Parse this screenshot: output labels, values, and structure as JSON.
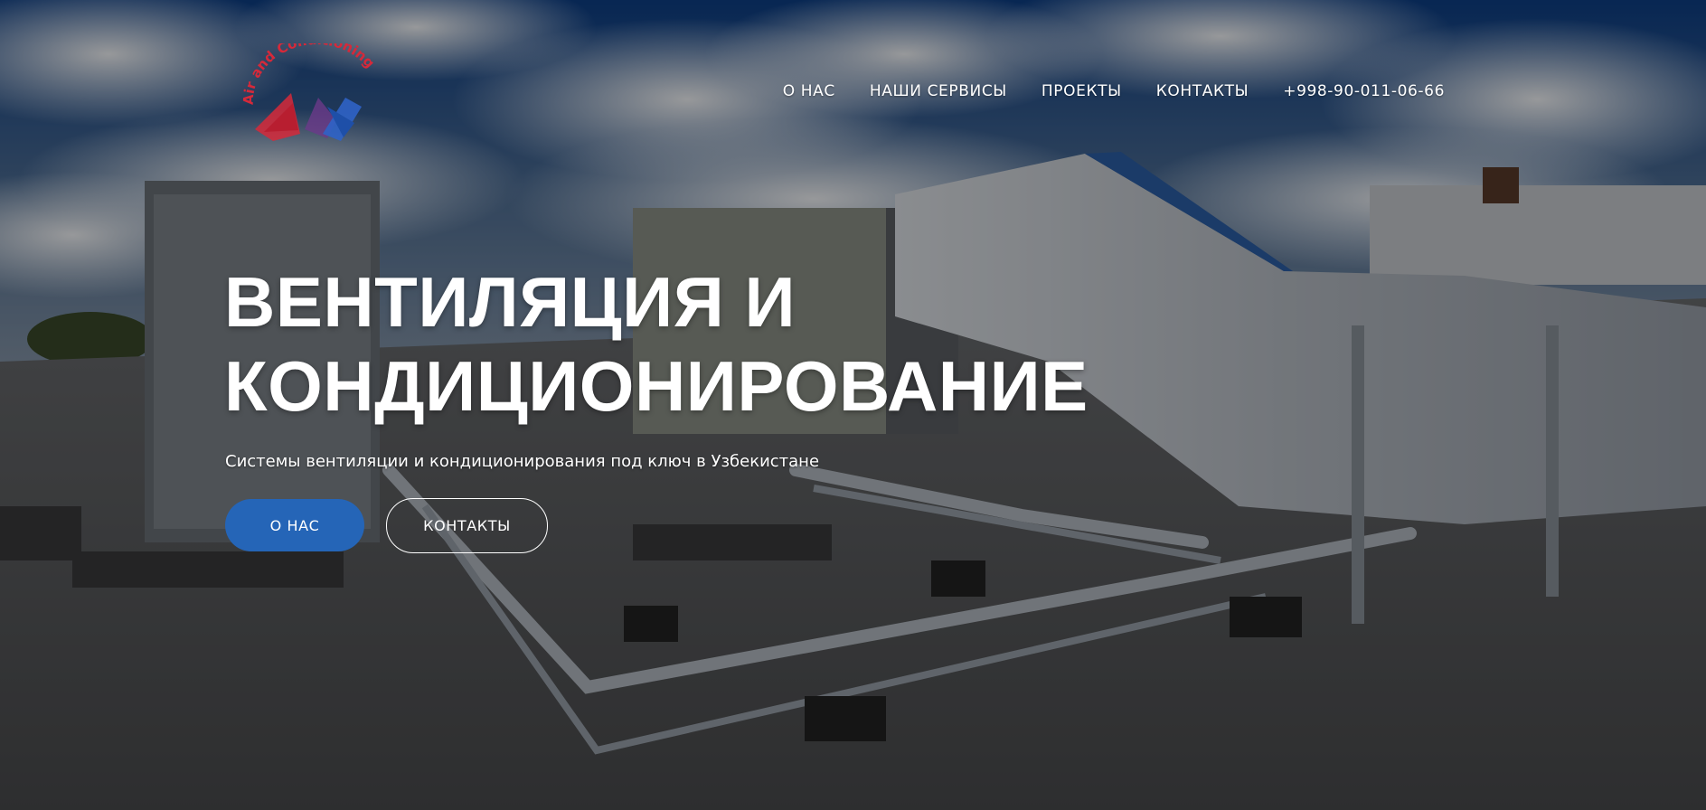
{
  "logo": {
    "text": "Air and Conditioning",
    "red": "#d6293a",
    "blue": "#2f63c6"
  },
  "nav": {
    "items": [
      {
        "label": "О НАС"
      },
      {
        "label": "НАШИ СЕРВИСЫ"
      },
      {
        "label": "ПРОЕКТЫ"
      },
      {
        "label": "КОНТАКТЫ"
      },
      {
        "label": "+998-90-011-06-66"
      }
    ]
  },
  "hero": {
    "title_line1": "ВЕНТИЛЯЦИЯ И",
    "title_line2": "КОНДИЦИОНИРОВАНИЕ",
    "subtitle": "Системы вентиляции и кондиционирования под ключ в Узбекистане",
    "primary_button": "О НАС",
    "secondary_button": "КОНТАКТЫ"
  },
  "colors": {
    "accent": "#2565b7",
    "text": "#ffffff"
  }
}
